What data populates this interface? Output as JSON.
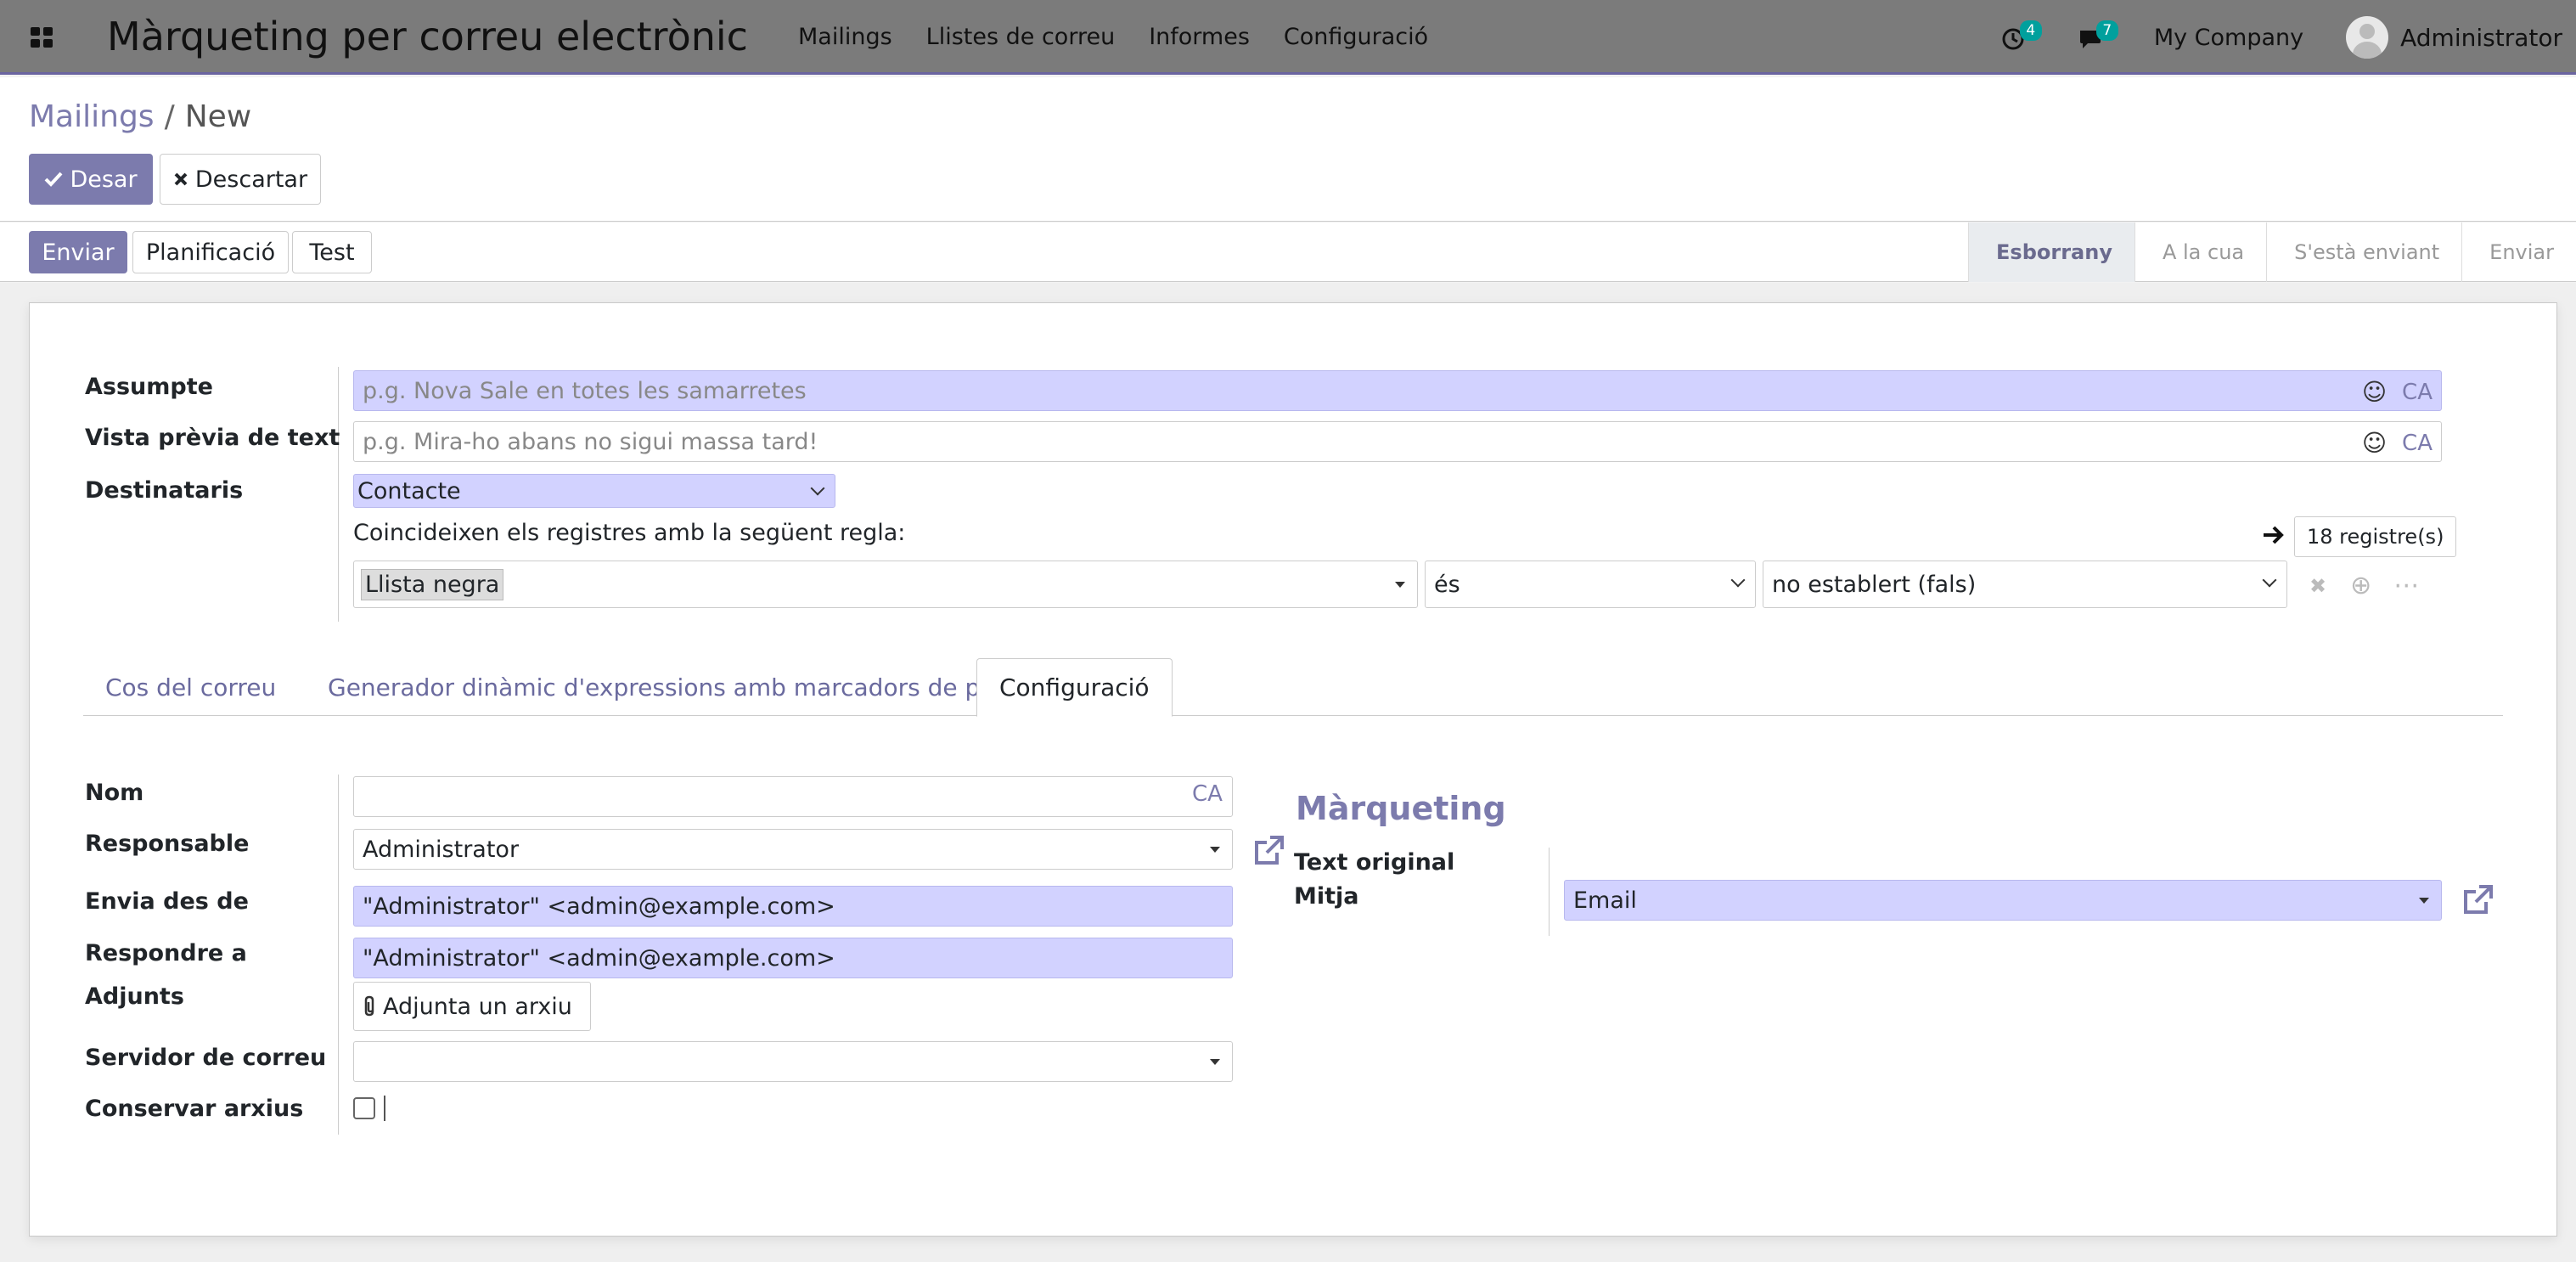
{
  "navbar": {
    "app_title": "Màrqueting per correu electrònic",
    "menu": [
      "Mailings",
      "Llistes de correu",
      "Informes",
      "Configuració"
    ],
    "activity_count": "4",
    "messages_count": "7",
    "company": "My Company",
    "user": "Administrator"
  },
  "breadcrumb": {
    "parent": "Mailings",
    "separator": "/",
    "current": "New"
  },
  "actions": {
    "save": "Desar",
    "discard": "Descartar"
  },
  "statusbar": {
    "buttons": [
      "Enviar",
      "Planificació",
      "Test"
    ],
    "stages": [
      "Esborrany",
      "A la cua",
      "S'està enviant",
      "Enviar"
    ],
    "active_stage": "Esborrany"
  },
  "form": {
    "subject_label": "Assumpte",
    "subject_placeholder": "p.g. Nova Sale en totes les samarretes",
    "preview_label": "Vista prèvia de text",
    "preview_placeholder": "p.g. Mira-ho abans no sigui massa tard!",
    "lang_code": "CA",
    "recipients_label": "Destinataris",
    "recipients_value": "Contacte",
    "domain_text": "Coincideixen els registres amb la següent regla:",
    "records_count": "18 registre(s)",
    "domain_field": "Llista negra",
    "domain_operator": "és",
    "domain_value": "no establert (fals)"
  },
  "tabs": [
    "Cos del correu",
    "Generador dinàmic d'expressions amb marcadors de posició",
    "Configuració"
  ],
  "settings": {
    "name_label": "Nom",
    "name_value": "",
    "responsible_label": "Responsable",
    "responsible_value": "Administrator",
    "send_from_label": "Envia des de",
    "send_from_value": "\"Administrator\" <admin@example.com>",
    "reply_to_label": "Respondre a",
    "reply_to_value": "\"Administrator\" <admin@example.com>",
    "attachments_label": "Adjunts",
    "attach_button": "Adjunta un arxiu",
    "mail_server_label": "Servidor de correu",
    "mail_server_value": "",
    "keep_archives_label": "Conservar arxius",
    "marketing_title": "Màrqueting",
    "source_label": "Text original",
    "medium_label": "Mitja",
    "medium_value": "Email"
  },
  "colors": {
    "brand": "#7c7bad",
    "required_field": "#d2d2ff",
    "navbar": "#7b7b7b"
  }
}
